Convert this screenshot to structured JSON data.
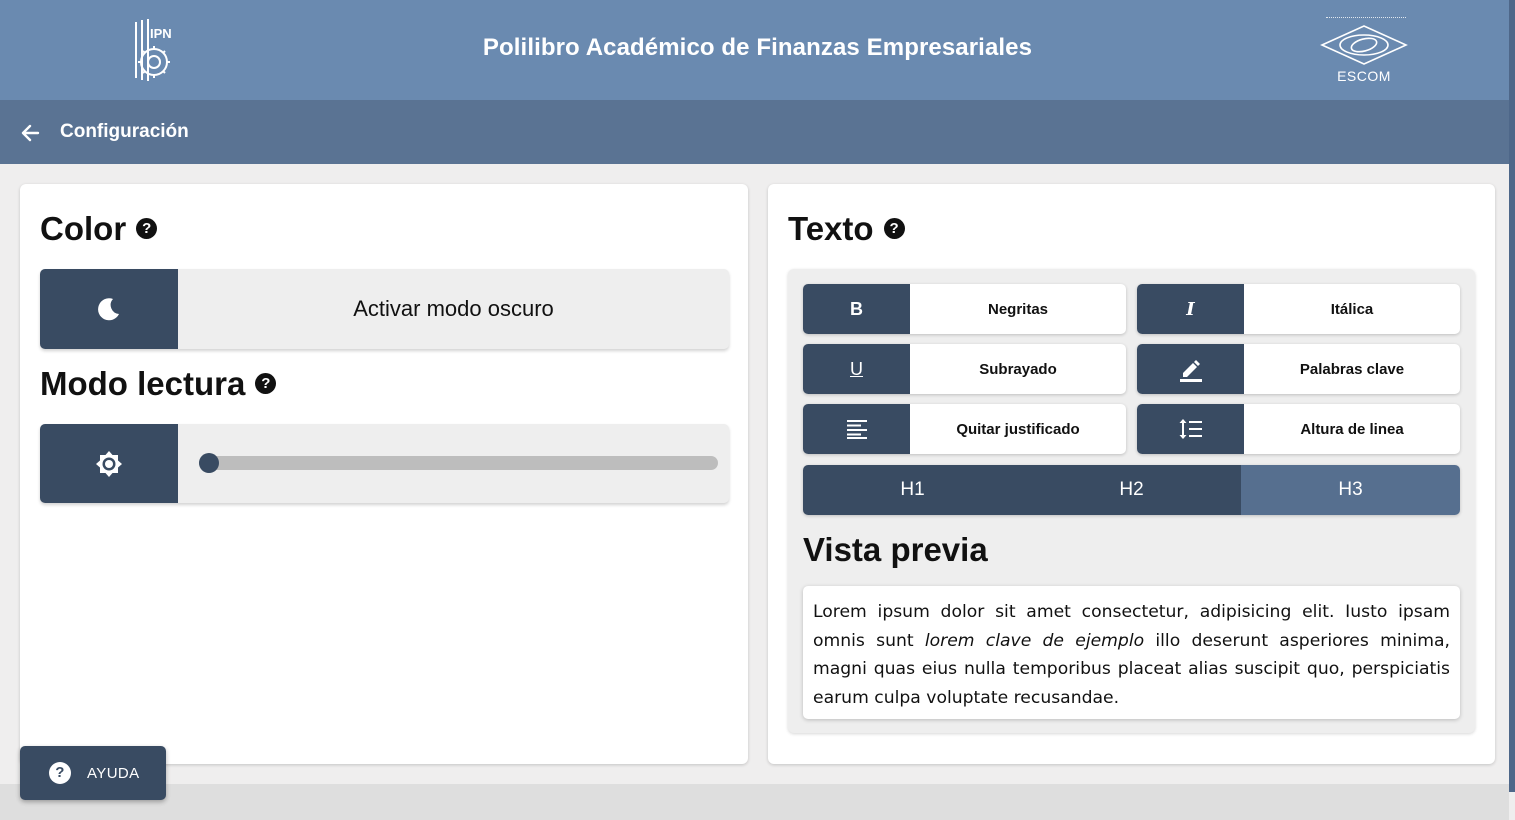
{
  "header": {
    "title": "Polilibro Académico de Finanzas Empresariales",
    "left_logo_text": "IPN",
    "right_logo_text": "ESCOM"
  },
  "subheader": {
    "back_icon": "arrow-left-icon",
    "title": "Configuración"
  },
  "color_section": {
    "title": "Color",
    "help_icon": "question-circle-icon",
    "help_glyph": "?",
    "dark_mode_icon": "moon-icon",
    "dark_mode_label": "Activar modo oscuro"
  },
  "reading_section": {
    "title": "Modo lectura",
    "help_glyph": "?",
    "icon": "brightness-icon",
    "slider_value": 0
  },
  "text_section": {
    "title": "Texto",
    "help_glyph": "?",
    "buttons": [
      {
        "glyph": "B",
        "icon": "bold-icon",
        "label": "Negritas"
      },
      {
        "glyph": "I",
        "icon": "italic-icon",
        "label": "Itálica"
      },
      {
        "glyph": "U",
        "icon": "underline-icon",
        "label": "Subrayado"
      },
      {
        "glyph": "",
        "icon": "highlighter-icon",
        "label": "Palabras clave"
      },
      {
        "glyph": "",
        "icon": "align-justify-icon",
        "label": "Quitar justificado"
      },
      {
        "glyph": "",
        "icon": "line-height-icon",
        "label": "Altura de linea"
      }
    ],
    "headings": [
      "H1",
      "H2",
      "H3"
    ],
    "active_heading": "H3",
    "preview_title": "Vista previa",
    "preview_text_before": "Lorem ipsum dolor sit amet consectetur, adipisicing elit. Iusto ipsam omnis sunt ",
    "preview_text_keyword": "lorem clave de ejemplo",
    "preview_text_after": " illo deserunt asperiores minima, magni quas eius nulla temporibus placeat alias suscipit quo, perspiciatis earum culpa voluptate recusandae."
  },
  "help_button": {
    "glyph": "?",
    "label": "AYUDA"
  },
  "colors": {
    "header_bg": "#6a8ab0",
    "subheader_bg": "#5a7393",
    "accent": "#394b62",
    "accent_active": "#566f8f",
    "page_bg": "#efeeee"
  }
}
